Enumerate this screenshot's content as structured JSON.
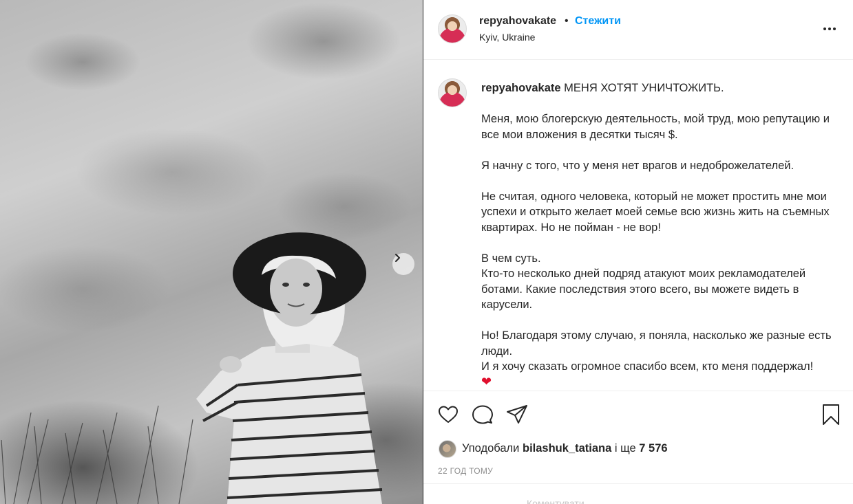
{
  "post": {
    "username": "repyahovakate",
    "follow_label": "Стежити",
    "location": "Kyiv, Ukraine",
    "caption_user": "repyahovakate",
    "caption_lines": [
      "МЕНЯ ХОТЯТ УНИЧТОЖИТЬ.",
      "",
      "Меня, мою блогерскую деятельность, мой труд, мою репутацию и все мои вложения в десятки тысяч $.",
      "",
      "Я начну с того, что у меня нет врагов и недоброжелателей.",
      "",
      "Не считая, одного человека, который не может простить мне мои успехи и открыто желает моей семье всю жизнь жить на съемных квартирах. Но не пойман - не вор!",
      "",
      "В чем суть.",
      "Кто-то несколько дней подряд атакуют моих рекламодателей ботами. Какие последствия этого всего, вы можете видеть в карусели.",
      "",
      "Но! Благодаря этому случаю, я поняла, насколько же разные есть люди.",
      "И я хочу сказать огромное спасибо всем, кто меня поддержал!"
    ],
    "caption_emoji": "❤",
    "likes_prefix": "Уподобали",
    "likes_user": "bilashuk_tatiana",
    "likes_mid": "і ще",
    "likes_count": "7 576",
    "timestamp": "22 год тому",
    "comment_placeholder": "Коментувати...",
    "icons": {
      "like": "heart-outline-icon",
      "comment": "comment-bubble-icon",
      "share": "paper-plane-icon",
      "save": "bookmark-icon",
      "more": "more-horizontal-icon",
      "carousel_next": "chevron-right-icon"
    },
    "colors": {
      "follow": "#0095f6",
      "text": "#262626",
      "muted": "#8e8e8e",
      "heart": "#e0102e"
    }
  }
}
